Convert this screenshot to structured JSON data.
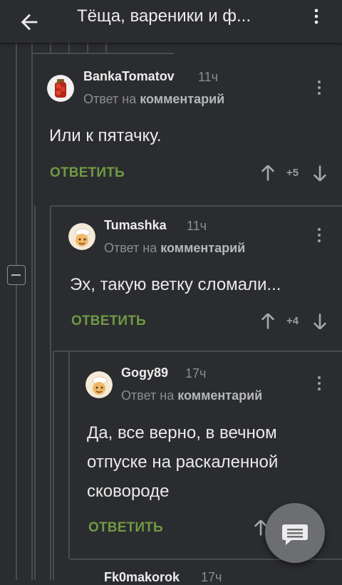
{
  "header": {
    "title": "Тёща, вареники и ф..."
  },
  "comments": [
    {
      "author": "BankaTomatov",
      "time": "11ч",
      "reply_prefix": "Ответ на",
      "reply_target": "комментарий",
      "text": "Или к пятачку.",
      "reply_label": "ОТВЕТИТЬ",
      "score": "+5"
    },
    {
      "author": "Tumashka",
      "time": "11ч",
      "reply_prefix": "Ответ на",
      "reply_target": "комментарий",
      "text": "Эх, такую ветку сломали...",
      "reply_label": "ОТВЕТИТЬ",
      "score": "+4"
    },
    {
      "author": "Gogy89",
      "time": "17ч",
      "reply_prefix": "Ответ на",
      "reply_target": "комментарий",
      "text_lines": [
        "Да, все верно, в вечном",
        "отпуске на раскаленной",
        "сковороде"
      ],
      "reply_label": "ОТВЕТИТЬ"
    }
  ],
  "partial_comment": {
    "author": "Fk0makorok",
    "time": "17ч"
  },
  "icons": {
    "back": "arrow-left-icon",
    "menu": "more-vertical-icon",
    "upvote": "arrow-up-icon",
    "downvote": "arrow-down-icon",
    "fab": "comment-icon",
    "collapse": "minus-box-icon"
  },
  "colors": {
    "background": "#2b2c2f",
    "reply": "#6f9a44",
    "muted": "#8c8d90"
  }
}
